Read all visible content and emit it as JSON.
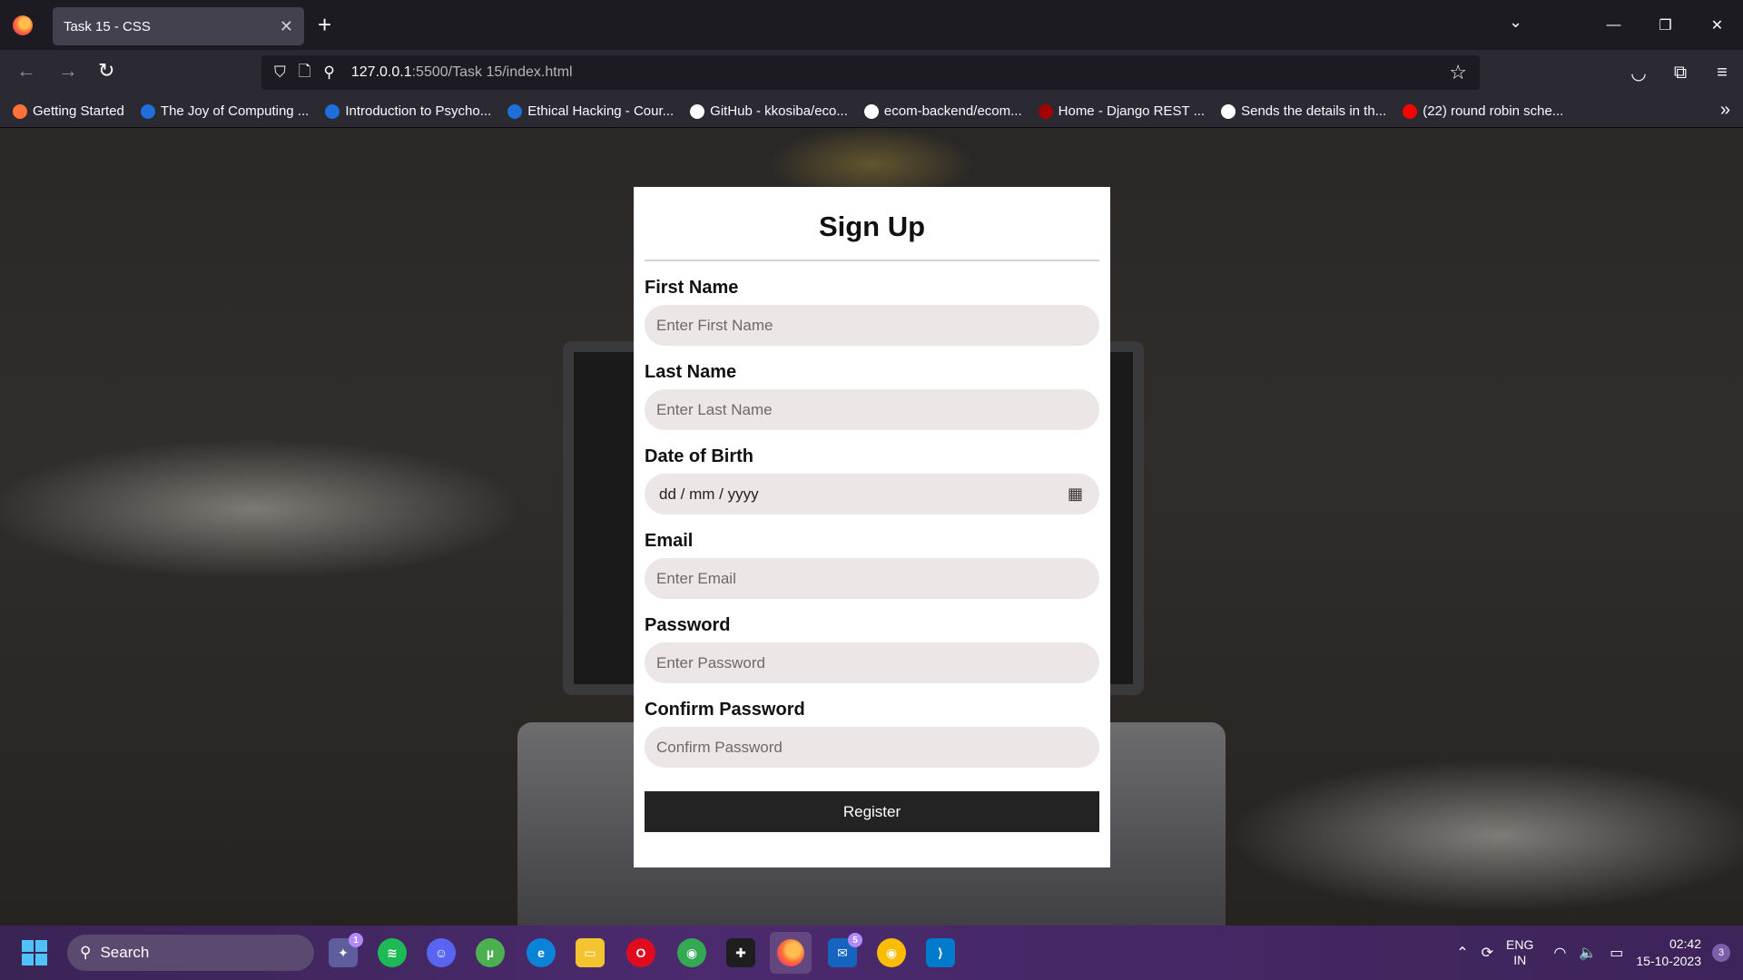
{
  "browser": {
    "tab_title": "Task 15 - CSS",
    "url_host": "127.0.0.1",
    "url_path": ":5500/Task 15/index.html",
    "bookmarks": [
      {
        "label": "Getting Started",
        "color": "#ff7139"
      },
      {
        "label": "The Joy of Computing ...",
        "color": "#1e6fd9"
      },
      {
        "label": "Introduction to Psycho...",
        "color": "#1e6fd9"
      },
      {
        "label": "Ethical Hacking - Cour...",
        "color": "#1e6fd9"
      },
      {
        "label": "GitHub - kkosiba/eco...",
        "color": "#ffffff"
      },
      {
        "label": "ecom-backend/ecom...",
        "color": "#ffffff"
      },
      {
        "label": "Home - Django REST ...",
        "color": "#a30000"
      },
      {
        "label": "Sends the details in th...",
        "color": "#ffffff"
      },
      {
        "label": "(22) round robin sche...",
        "color": "#ff0000"
      }
    ]
  },
  "form": {
    "title": "Sign Up",
    "first_name": {
      "label": "First Name",
      "placeholder": "Enter First Name"
    },
    "last_name": {
      "label": "Last Name",
      "placeholder": "Enter Last Name"
    },
    "dob": {
      "label": "Date of Birth",
      "placeholder": "dd / mm / yyyy"
    },
    "email": {
      "label": "Email",
      "placeholder": "Enter Email"
    },
    "password": {
      "label": "Password",
      "placeholder": "Enter Password"
    },
    "confirm_password": {
      "label": "Confirm Password",
      "placeholder": "Confirm Password"
    },
    "register_label": "Register"
  },
  "taskbar": {
    "search_label": "Search",
    "badge_1": "1",
    "badge_5": "5",
    "lang_line1": "ENG",
    "lang_line2": "IN",
    "time": "02:42",
    "date": "15-10-2023",
    "notifications": "3"
  },
  "colors": {
    "card_bg": "#ffffff",
    "input_bg": "#ece6e6",
    "button_bg": "#232323"
  }
}
